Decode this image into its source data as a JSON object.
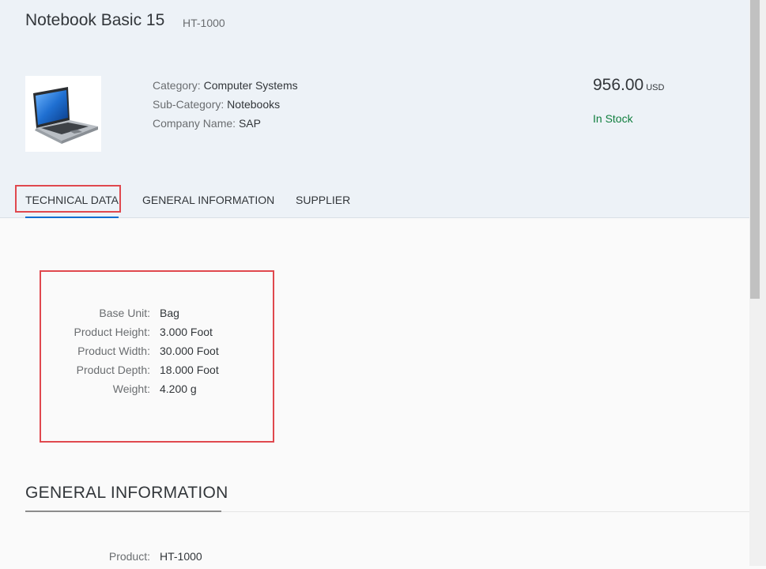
{
  "product": {
    "name": "Notebook Basic 15",
    "id": "HT-1000",
    "image_icon": "laptop-image",
    "attributes": [
      {
        "label": "Category:",
        "value": "Computer Systems"
      },
      {
        "label": "Sub-Category:",
        "value": "Notebooks"
      },
      {
        "label": "Company Name:",
        "value": "SAP"
      }
    ],
    "price": "956.00",
    "currency": "USD",
    "availability": "In Stock",
    "availability_color": "#107e3e"
  },
  "tabs": [
    {
      "label": "TECHNICAL DATA",
      "selected": true
    },
    {
      "label": "GENERAL INFORMATION",
      "selected": false
    },
    {
      "label": "SUPPLIER",
      "selected": false
    }
  ],
  "technical_data": [
    {
      "label": "Base Unit:",
      "value": "Bag"
    },
    {
      "label": "Product Height:",
      "value": "3.000 Foot"
    },
    {
      "label": "Product Width:",
      "value": "30.000 Foot"
    },
    {
      "label": "Product Depth:",
      "value": "18.000 Foot"
    },
    {
      "label": "Weight:",
      "value": "4.200 g"
    }
  ],
  "general_information": {
    "title": "GENERAL INFORMATION",
    "fields": [
      {
        "label": "Product:",
        "value": "HT-1000"
      }
    ]
  },
  "colors": {
    "accent": "#0a6ed1",
    "highlight": "#e0484e",
    "header_bg": "#edf2f7"
  }
}
